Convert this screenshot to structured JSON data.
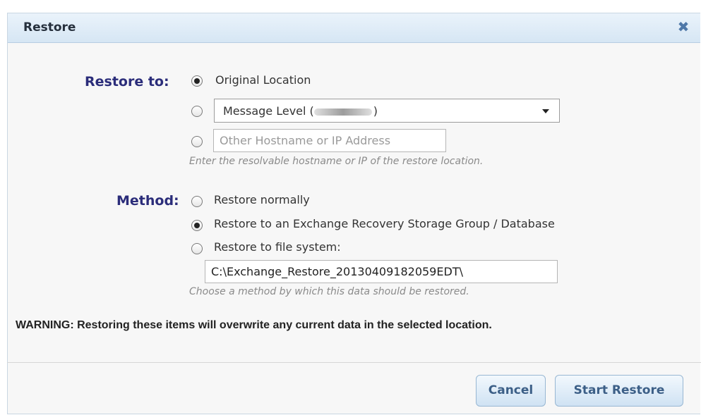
{
  "dialog": {
    "title": "Restore",
    "close_symbol": "✖",
    "close_icon": "close-icon"
  },
  "restore_to": {
    "label": "Restore to:",
    "options": {
      "original": {
        "label": "Original Location",
        "checked": true
      },
      "message_level": {
        "label_prefix": "Message Level (",
        "label_suffix": ")",
        "checked": false
      },
      "other_host": {
        "placeholder": "Other Hostname or IP Address",
        "checked": false
      }
    },
    "hint": "Enter the resolvable hostname or IP of the restore location."
  },
  "method": {
    "label": "Method:",
    "options": {
      "normal": {
        "label": "Restore normally",
        "checked": false
      },
      "recovery_group": {
        "label": "Restore to an Exchange Recovery Storage Group / Database",
        "checked": true
      },
      "file_system": {
        "label": "Restore to file system:",
        "checked": false
      }
    },
    "file_path": "C:\\Exchange_Restore_20130409182059EDT\\",
    "hint": "Choose a method by which this data should be restored."
  },
  "warning": "WARNING: Restoring these items will overwrite any current data in the selected location.",
  "buttons": {
    "cancel": "Cancel",
    "start": "Start Restore"
  }
}
